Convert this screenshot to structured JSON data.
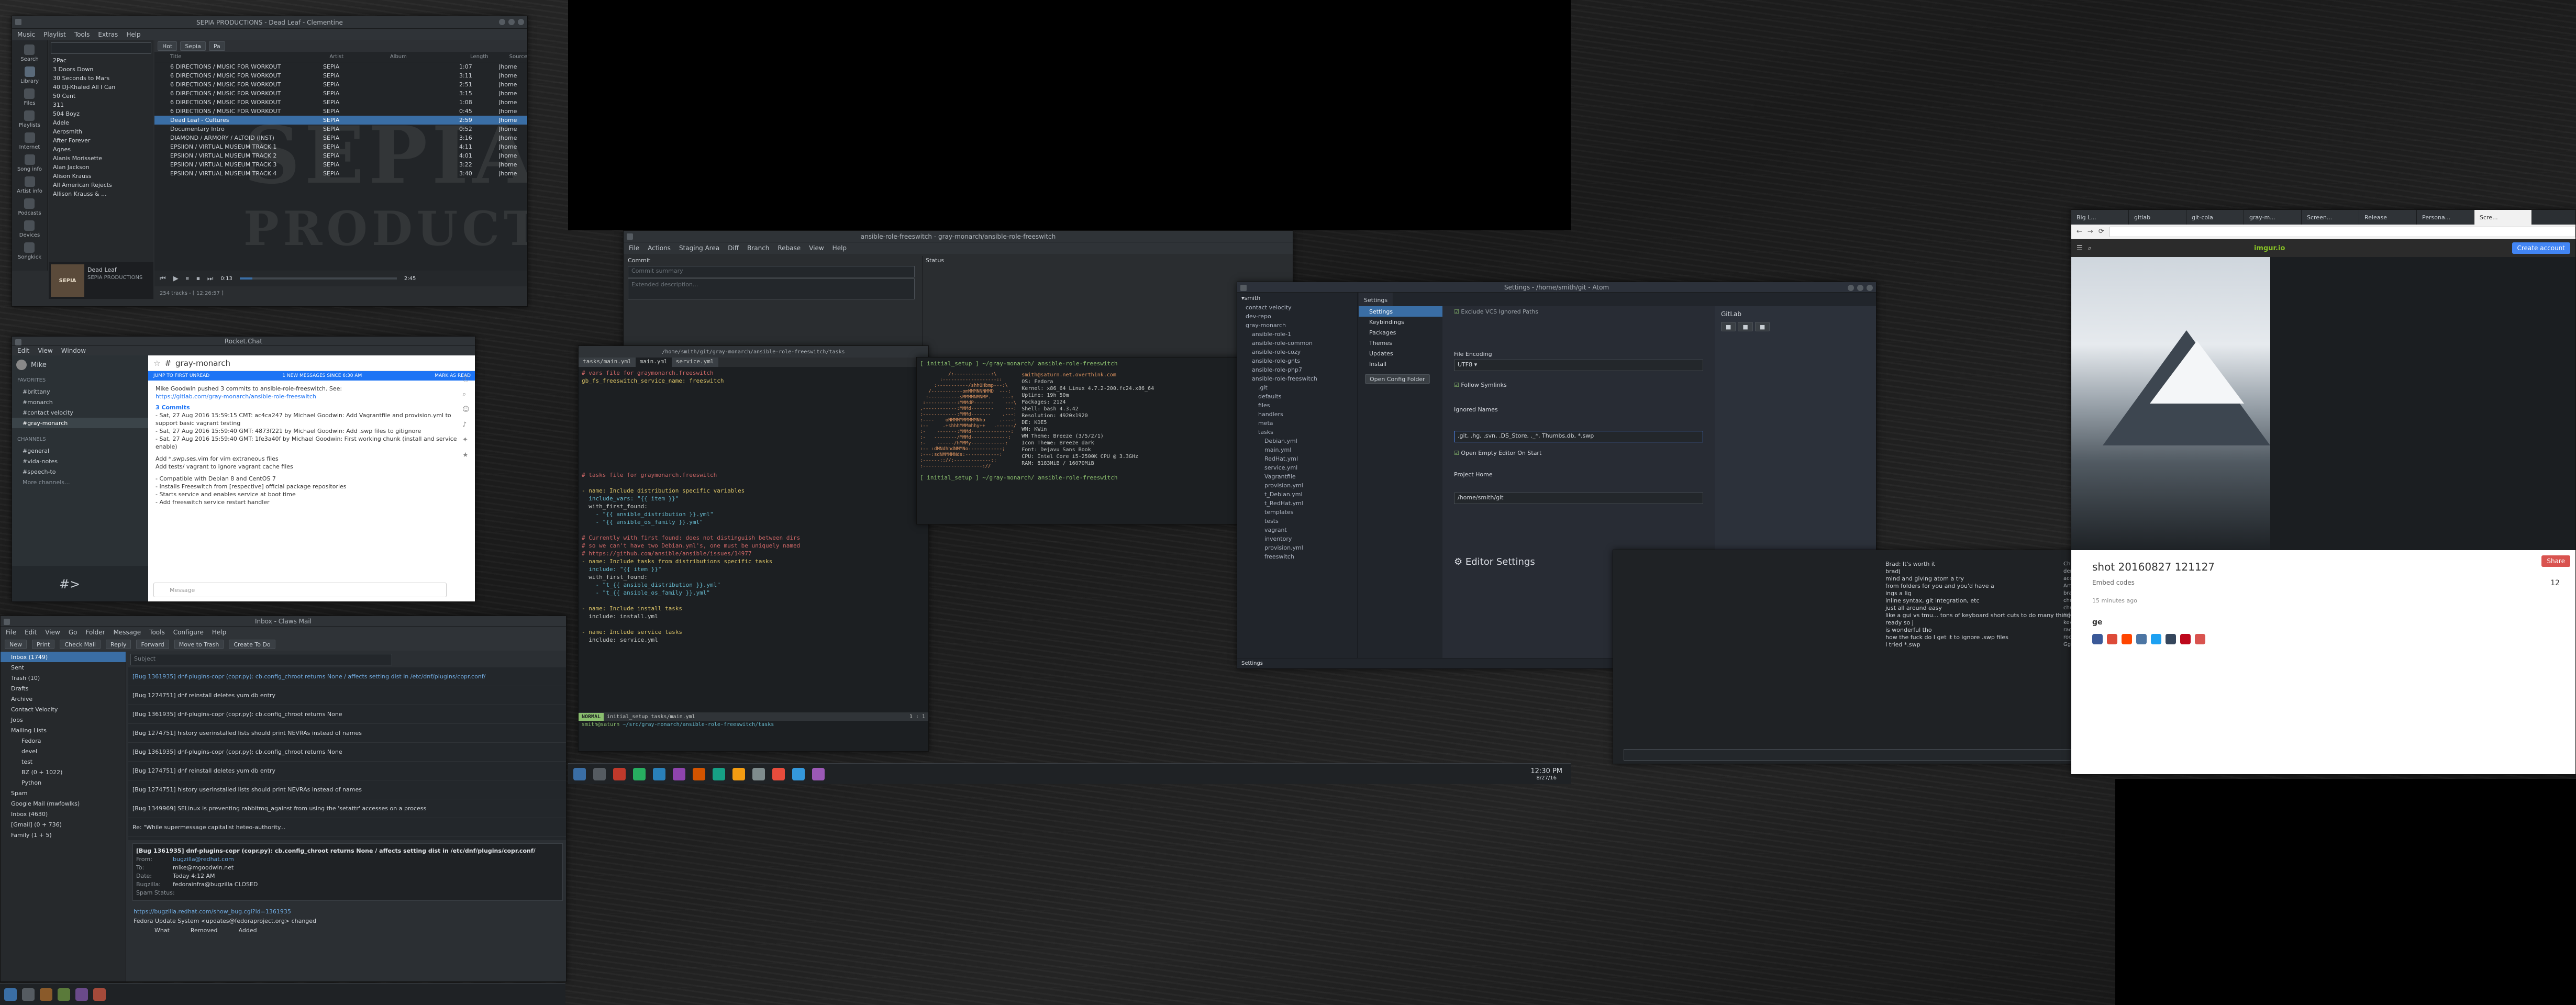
{
  "music": {
    "title": "SEPIA PRODUCTIONS - Dead Leaf - Clementine",
    "menu": [
      "Music",
      "Playlist",
      "Tools",
      "Extras",
      "Help"
    ],
    "sidebar": [
      "Search",
      "Library",
      "Files",
      "Playlists",
      "Internet",
      "Song info",
      "Artist info",
      "Podcasts",
      "Devices",
      "Songkick",
      "Artist Info"
    ],
    "library_items": [
      "2Pac",
      "3 Doors Down",
      "30 Seconds to Mars",
      "40 DJ-Khaled All I Can",
      "50 Cent",
      "311",
      "504 Boyz",
      "Adele",
      "Aerosmith",
      "After Forever",
      "Agnes",
      "Alanis Morissette",
      "Alan Jackson",
      "Alison Krauss",
      "All American Rejects",
      "Allison Krauss & ..."
    ],
    "columns": [
      "Title",
      "Artist",
      "Album",
      "Length",
      "Source",
      "Type"
    ],
    "tracks": [
      [
        "6 DIRECTIONS / MUSIC FOR WORKOUT",
        "SEPIA",
        "",
        "1:07",
        "Jhome"
      ],
      [
        "6 DIRECTIONS / MUSIC FOR WORKOUT",
        "SEPIA",
        "",
        "3:11",
        "Jhome"
      ],
      [
        "6 DIRECTIONS / MUSIC FOR WORKOUT",
        "SEPIA",
        "",
        "2:51",
        "Jhome"
      ],
      [
        "6 DIRECTIONS / MUSIC FOR WORKOUT",
        "SEPIA",
        "",
        "3:15",
        "Jhome"
      ],
      [
        "6 DIRECTIONS / MUSIC FOR WORKOUT",
        "SEPIA",
        "",
        "1:08",
        "Jhome"
      ],
      [
        "6 DIRECTIONS / MUSIC FOR WORKOUT",
        "SEPIA",
        "",
        "0:45",
        "Jhome"
      ],
      [
        "Dead Leaf - Cultures",
        "SEPIA",
        "",
        "2:59",
        "Jhome"
      ],
      [
        "Documentary Intro",
        "SEPIA",
        "",
        "0:52",
        "Jhome"
      ],
      [
        "DIAMOND / ARMORY / ALTOID (INST)",
        "SEPIA",
        "",
        "3:16",
        "Jhome"
      ],
      [
        "EPSIION / VIRTUAL MUSEUM TRACK 1",
        "SEPIA",
        "",
        "4:11",
        "Jhome"
      ],
      [
        "EPSIION / VIRTUAL MUSEUM TRACK 2",
        "SEPIA",
        "",
        "4:01",
        "Jhome"
      ],
      [
        "EPSIION / VIRTUAL MUSEUM TRACK 3",
        "SEPIA",
        "",
        "3:22",
        "Jhome"
      ],
      [
        "EPSIION / VIRTUAL MUSEUM TRACK 4",
        "SEPIA",
        "",
        "3:40",
        "Jhome"
      ]
    ],
    "now_playing_title": "Dead Leaf",
    "now_playing_artist": "SEPIA PRODUCTIONS",
    "status": "254 tracks - [ 12:26:57 ]",
    "time_left": "0:13",
    "time_right": "2:45",
    "banner_line1": "SEPIA",
    "banner_line2": "PRODUCTIONS"
  },
  "rocket": {
    "title": "Rocket.Chat",
    "menu": [
      "Edit",
      "View",
      "Window"
    ],
    "user": "Mike",
    "favorites_label": "FAVORITES",
    "channels": [
      "brittany",
      "monarch",
      "contact velocity",
      "gray-monarch"
    ],
    "channels_label": "CHANNELS",
    "other_channels": [
      "general",
      "vida-notes",
      "speech-to"
    ],
    "more": "More channels...",
    "room": "gray-monarch",
    "unread_banner": "JUMP TO FIRST UNREAD",
    "unread_count": "1 NEW MESSAGES SINCE 6:30 AM",
    "mark_read": "MARK AS READ",
    "msg1": "Mike Goodwin pushed 3 commits to ansible-role-freeswitch. See:",
    "msg1_link": "https://gitlab.com/gray-monarch/ansible-role-freeswitch",
    "commits_head": "3 Commits",
    "commit1": "- Sat, 27 Aug 2016 15:59:15 CMT: ac4ca247 by Michael Goodwin: Add Vagrantfile and provision.yml to support basic vagrant testing",
    "commit2": "- Sat, 27 Aug 2016 15:59:40 GMT: 4873f221 by Michael Goodwin: Add .swp files to gitignore",
    "commit3": "- Sat, 27 Aug 2016 15:59:40 GMT: 1fe3a40f by Michael Goodwin: First working chunk (install and service enable)",
    "body1": "Add *.swp,ses.vim for vim extraneous files",
    "body2": "Add tests/ vagrant to ignore vagrant cache files",
    "body3": "- Compatible with Debian 8 and CentOS 7",
    "body4": "- Installs Freeswitch from [respective] official package repositories",
    "body5": "- Starts service and enables service at boot time",
    "body6": "- Add freeswitch service restart handler",
    "composer_placeholder": "Message",
    "prompt": "#>"
  },
  "mail": {
    "title": "Inbox - Claws Mail",
    "menu": [
      "File",
      "Edit",
      "View",
      "Go",
      "Folder",
      "Message",
      "Tools",
      "Configure",
      "Help"
    ],
    "toolbar": [
      "New",
      "Print",
      "Check Mail",
      "Reply",
      "Forward",
      "Move to Trash",
      "Create To Do"
    ],
    "search_placeholder": "Subject",
    "folders": [
      "Inbox (1749)",
      "Sent",
      "Trash (10)",
      "Drafts",
      "Archive",
      "Contact Velocity",
      "Jobs",
      "Mailing Lists",
      "Fedora",
      "devel",
      "test",
      "BZ (0 + 1022)",
      "Python",
      "Spam",
      "Google Mail (mwfowlks)",
      "Inbox (4630)",
      "[Gmail] (0 + 736)",
      "Family (1 + 5)"
    ],
    "messages": [
      "[Bug 1361935] dnf-plugins-copr (copr.py): cb.config_chroot returns None / affects setting dist in /etc/dnf/plugins/copr.conf/",
      "[Bug 1274751] dnf reinstall deletes yum db entry",
      "[Bug 1361935] dnf-plugins-copr (copr.py): cb.config_chroot returns None",
      "[Bug 1274751] history userinstalled lists should print NEVRAs instead of names",
      "[Bug 1361935] dnf-plugins-copr (copr.py): cb.config_chroot returns None",
      "[Bug 1274751] dnf reinstall deletes yum db entry",
      "[Bug 1274751] history userinstalled lists should print NEVRAs instead of names",
      "[Bug 1349969] SELinux is preventing rabbitmq_against from using the 'setattr' accesses on a process",
      "Re: \"While supermessage capitalist heteo-authority..."
    ],
    "preview_subject": "[Bug 1361935] dnf-plugins-copr (copr.py): cb.config_chroot returns None / affects setting dist in /etc/dnf/plugins/copr.conf/",
    "preview_from": "From:",
    "preview_from_val": "bugzilla@redhat.com",
    "preview_to": "To:",
    "preview_to_val": "mike@mgoodwin.net",
    "preview_date": "Date:",
    "preview_date_val": "Today 4:12 AM",
    "preview_bug": "Bugzilla:",
    "preview_bug_val": "fedorainfra@bugzilla",
    "preview_status": "CLOSED",
    "spam_status": "Spam Status:",
    "footer1": "https://bugzilla.redhat.com/show_bug.cgi?id=1361935",
    "footer2": "Fedora Update System <updates@fedoraproject.org> changed",
    "footer3": "What",
    "footer4": "Removed",
    "footer5": "Added"
  },
  "gitcola": {
    "title": "ansible-role-freeswitch - gray-monarch/ansible-role-freeswitch",
    "menu": [
      "File",
      "Actions",
      "Staging Area",
      "Diff",
      "Branch",
      "Rebase",
      "View",
      "Help"
    ],
    "commit_label": "Commit",
    "status_label": "Status",
    "summary_placeholder": "Commit summary",
    "desc_placeholder": "Extended description..."
  },
  "vim": {
    "tabs": [
      "tasks/main.yml",
      "main.yml",
      "service.yml"
    ],
    "path": "/home/smith/git/gray-monarch/ansible-role-freeswitch/tasks",
    "lines": [
      "# vars file for graymonarch.freeswitch",
      "gb_fs_freeswitch_service_name: freeswitch",
      "",
      "",
      "",
      "",
      "",
      "",
      "",
      "",
      "",
      "",
      "",
      "# tasks file for graymonarch.freeswitch",
      "",
      "- name: Include distribution specific variables",
      "  include_vars: \"{{ item }}\"",
      "  with_first_found:",
      "    - \"{{ ansible_distribution }}.yml\"",
      "    - \"{{ ansible_os_family }}.yml\"",
      "",
      "# Currently with_first_found: does not distinguish between dirs",
      "# so we can't have two Debian.yml's, one must be uniquely named",
      "# https://github.com/ansible/ansible/issues/14977",
      "- name: Include tasks from distributions specific tasks",
      "  include: \"{{ item }}\"",
      "  with_first_found:",
      "    - \"t_{{ ansible_distribution }}.yml\"",
      "    - \"t_{{ ansible_os_family }}.yml\"",
      "",
      "- name: Include install tasks",
      "  include: install.yml",
      "",
      "- name: Include service tasks",
      "  include: service.yml"
    ],
    "mode": "NORMAL",
    "branch": "initial_setup",
    "file": "tasks/main.yml",
    "pos": "1 : 1",
    "shell_prompt": "smith@saturn",
    "shell_path": "~/src/gray-monarch/ansible-role-freeswitch/tasks"
  },
  "neofetch": {
    "prompt": "[ initial_setup ] ~/gray-monarch/ ansible-role-freeswitch",
    "user": "smith@saturn.net.overthink.com",
    "lines": [
      "OS: Fedora",
      "Kernel: x86_64 Linux 4.7.2-200.fc24.x86_64",
      "Uptime: 19h 50m",
      "Packages: 2124",
      "Shell: bash 4.3.42",
      "Resolution: 4920x1920",
      "DE: KDE5",
      "WM: KWin",
      "WM Theme: Breeze (3/5/2/1)",
      "Icon Theme: Breeze dark",
      "Font: Dejavu Sans Book",
      "CPU: Intel Core i5-2500K CPU @ 3.3GHz",
      "RAM: 8183MiB / 16070MiB"
    ]
  },
  "atom": {
    "title": "Settings - /home/smith/git - Atom",
    "root": "smith",
    "tree": [
      "contact velocity",
      "dev-repo",
      "gray-monarch",
      "ansible-role-1",
      "ansible-role-common",
      "ansible-role-cozy",
      "ansible-role-gnts",
      "ansible-role-php7",
      "ansible-role-freeswitch",
      ".git",
      "defaults",
      "files",
      "handlers",
      "meta",
      "tasks",
      "Debian.yml",
      "main.yml",
      "RedHat.yml",
      "service.yml",
      "Vagrantfile",
      "provision.yml",
      "t_Debian.yml",
      "t_RedHat.yml",
      "templates",
      "tests",
      "vagrant",
      "inventory",
      "provision.yml",
      "freeswitch"
    ],
    "settings_tab": "Settings",
    "nav": [
      "Settings",
      "Keybindings",
      "Packages",
      "Themes",
      "Updates",
      "Install"
    ],
    "open_config": "Open Config Folder",
    "option1": "Exclude VCS Ignored Paths",
    "encoding_label": "File Encoding",
    "encoding_value": "UTF8",
    "follow_label": "Follow Symlinks",
    "ignored_label": "Ignored Names",
    "ignored_value": ".git, .hg, .svn, .DS_Store, ._*, Thumbs.db, *.swp",
    "empty_label": "Open Empty Editor On Start",
    "project_label": "Project Home",
    "project_value": "/home/smith/git",
    "editor_settings": "Editor Settings",
    "gitlab_label": "GitLab",
    "status_left": "Settings"
  },
  "chat2": {
    "nicks": [
      "Charlie's",
      "derrick",
      "acefrom",
      "ArtonTeck",
      "brad1",
      "chris",
      "chriss",
      "Infodonk",
      "kev",
      "ragatoe",
      "root",
      "Gguimon"
    ],
    "lines": [
      "Brad: It's worth it",
      "bradj",
      "mind and giving atom a try",
      "from folders for you and you'd have a",
      "ings a lig",
      "inline syntax, git integration, etc",
      "just all around easy",
      "like a gui vs tmu... tons of keyboard short cuts to do many things",
      "ready so j",
      "is wonderful tho",
      "how the fuck do I get it to ignore .swp files",
      "I tried *.swp"
    ]
  },
  "chrome": {
    "tabs": [
      "Big L...",
      "gitlab",
      "git-cola",
      "gray-m...",
      "Screen...",
      "Release",
      "Persona...",
      "Scre..."
    ],
    "url": "imgur.io",
    "create_account": "Create account",
    "screenshot_title": "shot 20160827 121127",
    "embed": "Embed codes",
    "views": "12",
    "time_ago": "15 minutes ago",
    "share": "Share",
    "section": "ge"
  },
  "taskbar": {
    "clock": "12:30 PM",
    "date": "8/27/16"
  },
  "colors": {
    "accent": "#3a6ea5",
    "chrome_blue": "#4285f4",
    "red": "#d9534f"
  }
}
